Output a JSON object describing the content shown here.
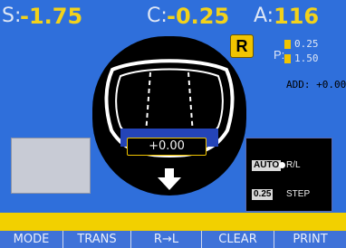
{
  "top_readout": {
    "s_label": "S:",
    "s_value": "-1.75",
    "c_label": "C:",
    "c_value": "-0.25",
    "a_label": "A:",
    "a_value": "116"
  },
  "lens": {
    "eye": "R",
    "center_value": "+0.00"
  },
  "prism": {
    "label": "P:",
    "line1": "0.25",
    "line2": "1.50"
  },
  "add": {
    "text": "ADD: +0.00"
  },
  "auto_mode": {
    "tag": "AUTO",
    "text": "R/L"
  },
  "step": {
    "tag": "0.25",
    "text": "STEP"
  },
  "menu": {
    "items": [
      "MODE",
      "TRANS",
      "R→L",
      "CLEAR",
      "PRINT"
    ]
  },
  "colors": {
    "screen_bg": "#2f6fdb",
    "readout_yellow": "#f3d21a",
    "badge_yellow": "#f1c400",
    "lens_bg": "#000000",
    "menu_bg": "#3f72d8",
    "status_bar": "#f2d000"
  },
  "icons": [
    "down-arrow-icon",
    "lens-frame-icon"
  ]
}
